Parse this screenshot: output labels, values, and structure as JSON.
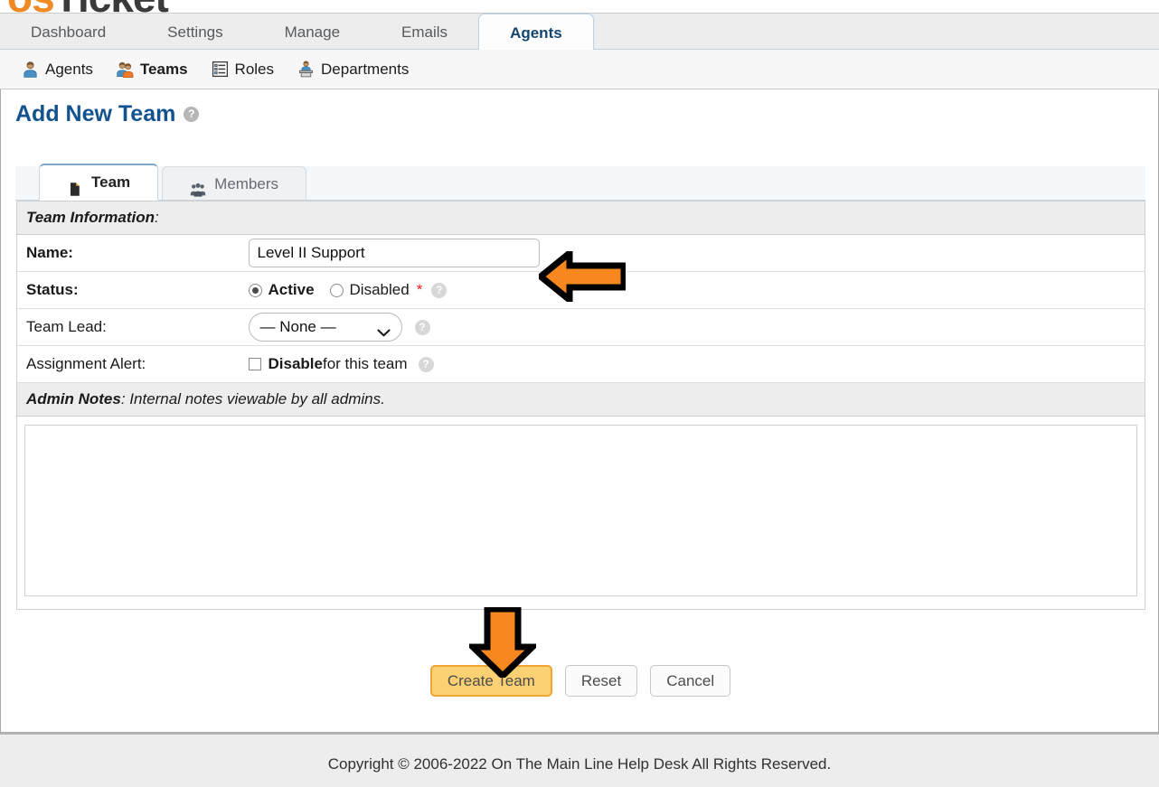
{
  "brand": {
    "logo_os": "os",
    "logo_ticket": "Ticket"
  },
  "topnav": {
    "tabs": [
      {
        "label": "Dashboard",
        "active": false
      },
      {
        "label": "Settings",
        "active": false
      },
      {
        "label": "Manage",
        "active": false
      },
      {
        "label": "Emails",
        "active": false
      },
      {
        "label": "Agents",
        "active": true
      }
    ]
  },
  "subnav": {
    "items": [
      {
        "label": "Agents",
        "icon": "agent-person-icon",
        "active": false
      },
      {
        "label": "Teams",
        "icon": "team-people-icon",
        "active": true
      },
      {
        "label": "Roles",
        "icon": "roles-list-icon",
        "active": false
      },
      {
        "label": "Departments",
        "icon": "departments-desk-icon",
        "active": false
      }
    ]
  },
  "page": {
    "title": "Add New Team",
    "help_icon": "help-question-icon"
  },
  "form_tabs": [
    {
      "label": "Team",
      "icon": "file-icon",
      "active": true
    },
    {
      "label": "Members",
      "icon": "group-icon",
      "active": false
    }
  ],
  "team_information": {
    "section_heading_bold": "Team Information",
    "section_heading_rest": ":",
    "name": {
      "label": "Name:",
      "value": "Level II Support",
      "placeholder": ""
    },
    "status": {
      "label": "Status:",
      "options": [
        {
          "label": "Active",
          "selected": true
        },
        {
          "label": "Disabled",
          "selected": false
        }
      ],
      "required_mark": "*"
    },
    "team_lead": {
      "label": "Team Lead:",
      "selected": "— None —"
    },
    "assignment_alert": {
      "label": "Assignment Alert:",
      "checked": false,
      "checkbox_bold": "Disable",
      "checkbox_rest": " for this team"
    }
  },
  "admin_notes": {
    "heading_bold": "Admin Notes",
    "heading_rest": ": Internal notes viewable by all admins.",
    "value": "",
    "placeholder": ""
  },
  "actions": {
    "create": "Create Team",
    "reset": "Reset",
    "cancel": "Cancel"
  },
  "footer": {
    "copyright": "Copyright © 2006-2022 On The Main Line Help Desk All Rights Reserved."
  },
  "annotations": {
    "arrow_to_name_field": "left-arrow-pointing-at-name-field",
    "arrow_to_create_button": "down-arrow-pointing-at-create-team-button",
    "arrow_color": "#F7871F",
    "arrow_outline": "#000000"
  },
  "colors": {
    "title_blue": "#12538F",
    "active_tab_blue": "#14456F",
    "primary_button_fill": "#FCD173",
    "primary_button_border": "#F0A434",
    "required_red": "#E02020",
    "chrome_gray": "#EDEDED"
  }
}
